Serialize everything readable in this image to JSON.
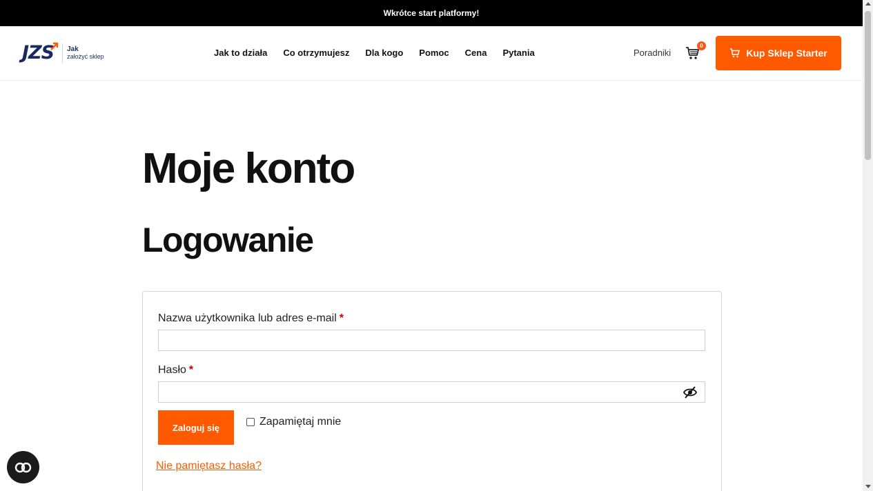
{
  "announcement": {
    "text": "Wkrótce start platformy!"
  },
  "header": {
    "logo": {
      "mark": "JZS",
      "line1": "Jak",
      "line2": "założyć sklep",
      "icon": "arrow-up-right-icon"
    },
    "nav": [
      "Jak to działa",
      "Co otrzymujesz",
      "Dla kogo",
      "Pomoc",
      "Cena",
      "Pytania"
    ],
    "guides_label": "Poradniki",
    "cart": {
      "icon": "cart-icon",
      "count": "0"
    },
    "buy_button_label": "Kup Sklep Starter"
  },
  "main": {
    "page_title": "Moje konto",
    "section_title": "Logowanie",
    "form": {
      "username_label": "Nazwa użytkownika lub adres e-mail",
      "required_mark": "*",
      "username_value": "",
      "password_label": "Hasło",
      "password_value": "",
      "password_toggle_icon": "eye-off-icon",
      "login_button_label": "Zaloguj się",
      "remember_label": "Zapamiętaj mnie",
      "remember_checked": false,
      "lost_password_link": "Nie pamiętasz hasła?"
    }
  },
  "chat_widget": {
    "icon": "chat-icon"
  },
  "colors": {
    "accent": "#ff5a00",
    "brand_navy": "#1a2a5e",
    "announcement_bg": "#000000"
  }
}
